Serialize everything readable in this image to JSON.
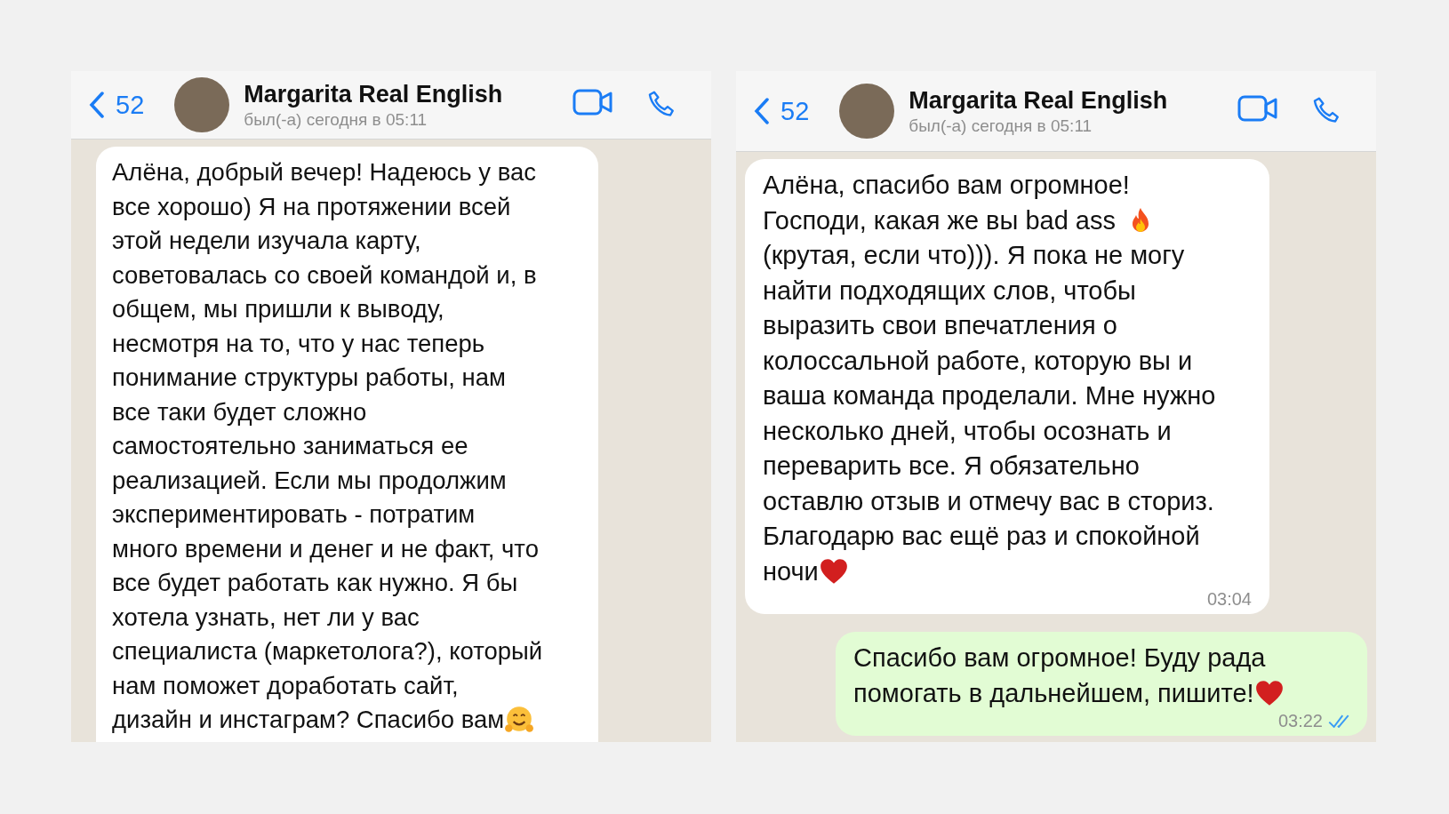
{
  "panels": [
    {
      "header": {
        "back_count": "52",
        "name": "Margarita Real English",
        "status": "был(-а) сегодня в 05:11"
      },
      "messages": [
        {
          "kind": "incoming",
          "lines": [
            {
              "text": "Алёна, добрый вечер! Надеюсь у вас"
            },
            {
              "text": "все хорошо) Я на протяжении всей"
            },
            {
              "text": "этой недели изучала карту,"
            },
            {
              "text": "советовалась со своей командой и, в"
            },
            {
              "text": "общем, мы пришли к выводу,"
            },
            {
              "text": "несмотря на то, что у нас теперь"
            },
            {
              "text": "понимание структуры работы, нам"
            },
            {
              "text": "все таки будет сложно"
            },
            {
              "text": "самостоятельно заниматься ее"
            },
            {
              "text": "реализацией. Если мы продолжим"
            },
            {
              "text": "экспериментировать - потратим"
            },
            {
              "text": "много времени и денег и не факт, что"
            },
            {
              "text": "все будет работать как нужно. Я бы"
            },
            {
              "text": "хотела узнать, нет ли у вас"
            },
            {
              "text": "специалиста (маркетолога?), который"
            },
            {
              "text": "нам поможет доработать сайт,"
            },
            {
              "text": "дизайн и инстаграм? Спасибо вам",
              "icon": {
                "kind": "hug"
              }
            }
          ]
        }
      ]
    },
    {
      "header": {
        "back_count": "52",
        "name": "Margarita Real English",
        "status": "был(-а) сегодня в 05:11"
      },
      "messages": [
        {
          "kind": "incoming",
          "time": "03:04",
          "lines": [
            {
              "text": "Алёна, спасибо вам огромное!"
            },
            {
              "text": "Господи, какая же вы bad ass",
              "icon": {
                "kind": "fire"
              }
            },
            {
              "text": "(крутая, если что))). Я пока не могу"
            },
            {
              "text": "найти подходящих слов, чтобы"
            },
            {
              "text": "выразить свои впечатления о"
            },
            {
              "text": "колоссальной работе, которую вы и"
            },
            {
              "text": "ваша команда проделали. Мне нужно"
            },
            {
              "text": "несколько дней, чтобы осознать и"
            },
            {
              "text": "переварить все. Я обязательно"
            },
            {
              "text": "оставлю отзыв и отмечу вас в сториз."
            },
            {
              "text": "Благодарю вас ещё раз и спокойной"
            },
            {
              "text": "ночи",
              "icon": {
                "kind": "heart"
              }
            }
          ]
        },
        {
          "kind": "outgoing",
          "time": "03:22",
          "read": true,
          "lines": [
            {
              "text": "Спасибо вам огромное! Буду рада"
            },
            {
              "text": "помогать в дальнейшем, пишите!",
              "icon": {
                "kind": "heart"
              }
            }
          ]
        }
      ]
    }
  ]
}
